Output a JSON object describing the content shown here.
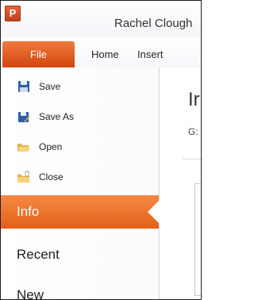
{
  "window": {
    "title": "Rachel Clough",
    "app_logo_letter": "P"
  },
  "ribbon": {
    "tabs": [
      {
        "label": "File"
      },
      {
        "label": "Home"
      },
      {
        "label": "Insert"
      }
    ]
  },
  "backstage": {
    "commands": [
      {
        "label": "Save",
        "icon": "save-icon"
      },
      {
        "label": "Save As",
        "icon": "save-as-icon"
      },
      {
        "label": "Open",
        "icon": "open-folder-icon"
      },
      {
        "label": "Close",
        "icon": "close-folder-icon"
      }
    ],
    "nav": [
      {
        "label": "Info",
        "active": true
      },
      {
        "label": "Recent",
        "active": false
      },
      {
        "label": "New",
        "active": false
      }
    ]
  },
  "info_panel": {
    "heading": "Ir",
    "path": "G:"
  },
  "colors": {
    "accent": "#e35f17",
    "file_tab": "#d1460f"
  }
}
